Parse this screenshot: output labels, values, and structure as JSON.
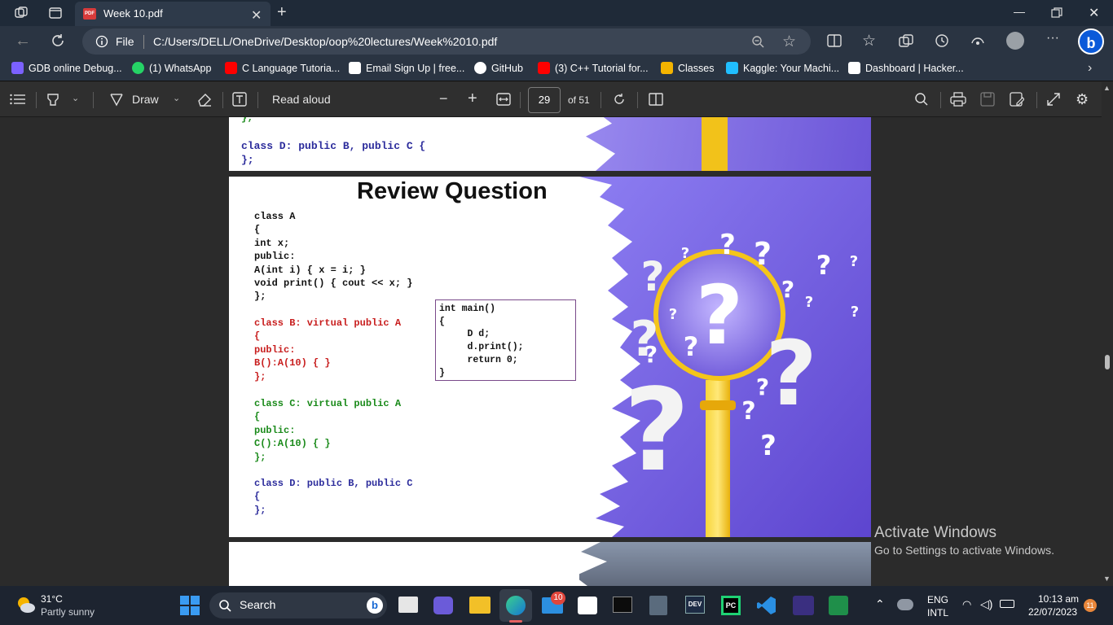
{
  "browser": {
    "tab_title": "Week 10.pdf",
    "address_prefix": "File",
    "address_url": "C:/Users/DELL/OneDrive/Desktop/oop%20lectures/Week%2010.pdf"
  },
  "bookmarks": [
    {
      "label": "GDB online Debug...",
      "icon": "gdb-icon",
      "color": "#7b61ff"
    },
    {
      "label": "(1) WhatsApp",
      "icon": "whatsapp-icon",
      "color": "#25d366"
    },
    {
      "label": "C Language Tutoria...",
      "icon": "youtube-icon",
      "color": "#ff0000"
    },
    {
      "label": "Email Sign Up | free...",
      "icon": "email-icon",
      "color": "#ffffff"
    },
    {
      "label": "GitHub",
      "icon": "github-icon",
      "color": "#ffffff"
    },
    {
      "label": "(3) C++ Tutorial for...",
      "icon": "youtube-icon",
      "color": "#ff0000"
    },
    {
      "label": "Classes",
      "icon": "classroom-icon",
      "color": "#f4b400"
    },
    {
      "label": "Kaggle: Your Machi...",
      "icon": "kaggle-icon",
      "color": "#20beff"
    },
    {
      "label": "Dashboard | Hacker...",
      "icon": "hackerrank-icon",
      "color": "#ffffff"
    }
  ],
  "pdf_toolbar": {
    "draw_label": "Draw",
    "read_aloud_label": "Read aloud",
    "page_number": "29",
    "page_total": "of 51"
  },
  "slide_top": {
    "line1": "};",
    "line2": "class D: public B, public C {",
    "line3": "};"
  },
  "slide": {
    "title": "Review Question",
    "class_a": [
      "class A",
      "{",
      "int x;",
      "public:",
      "A(int i) { x = i; }",
      "void print() { cout << x; }",
      "};"
    ],
    "class_b": [
      "class B: virtual public A",
      "{",
      "public:",
      "B():A(10) { }",
      "};"
    ],
    "class_c": [
      "class C: virtual public A",
      "{",
      "public:",
      "C():A(10) { }",
      "};"
    ],
    "class_d": [
      "class D: public B, public C",
      "{",
      "};"
    ],
    "main_box": [
      "int main()",
      "{",
      "     D d;",
      "     d.print();",
      "     return 0;",
      "}"
    ]
  },
  "watermark": {
    "line1": "Activate Windows",
    "line2": "Go to Settings to activate Windows."
  },
  "taskbar": {
    "weather_temp": "31°C",
    "weather_desc": "Partly sunny",
    "search_label": "Search",
    "mail_badge": "10",
    "lang_top": "ENG",
    "lang_bottom": "INTL",
    "time": "10:13 am",
    "date": "22/07/2023",
    "notif_count": "11"
  }
}
